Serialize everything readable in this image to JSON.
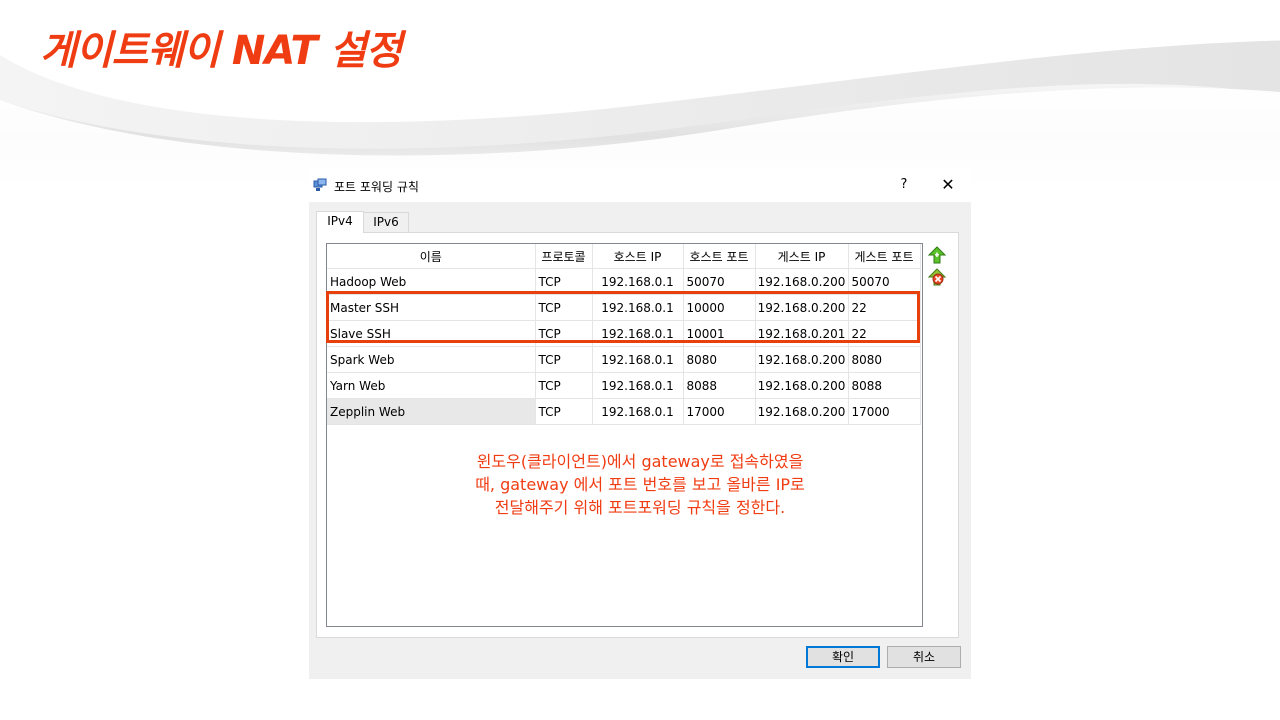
{
  "slide": {
    "title": "게이트웨이 NAT 설정",
    "title_color": "#f03c12",
    "note_lines": [
      "윈도우(클라이언트)에서 gateway로 접속하였을",
      "때, gateway 에서 포트 번호를 보고 올바른 IP로",
      "전달해주기 위해 포트포워딩 규칙을 정한다."
    ],
    "highlight_color": "#e8400d"
  },
  "dialog": {
    "title": "포트 포워딩 규칙",
    "help_label": "?",
    "close_label": "✕",
    "icon": "network-icon",
    "tabs": [
      {
        "label": "IPv4",
        "active": true
      },
      {
        "label": "IPv6",
        "active": false
      }
    ],
    "table": {
      "columns": [
        "이름",
        "프로토콜",
        "호스트 IP",
        "호스트 포트",
        "게스트 IP",
        "게스트 포트"
      ],
      "rows": [
        [
          "Hadoop Web",
          "TCP",
          "192.168.0.1",
          "50070",
          "192.168.0.200",
          "50070"
        ],
        [
          "Master SSH",
          "TCP",
          "192.168.0.1",
          "10000",
          "192.168.0.200",
          "22"
        ],
        [
          "Slave SSH",
          "TCP",
          "192.168.0.1",
          "10001",
          "192.168.0.201",
          "22"
        ],
        [
          "Spark Web",
          "TCP",
          "192.168.0.1",
          "8080",
          "192.168.0.200",
          "8080"
        ],
        [
          "Yarn Web",
          "TCP",
          "192.168.0.1",
          "8088",
          "192.168.0.200",
          "8088"
        ],
        [
          "Zepplin Web",
          "TCP",
          "192.168.0.1",
          "17000",
          "192.168.0.200",
          "17000"
        ]
      ]
    },
    "side_buttons": [
      "add-rule-icon",
      "remove-rule-icon"
    ],
    "ok_label": "확인",
    "cancel_label": "취소"
  }
}
